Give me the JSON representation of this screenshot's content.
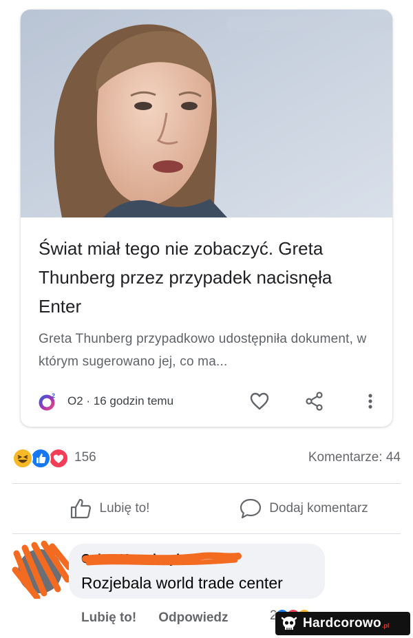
{
  "article": {
    "headline": "Świat miał tego nie zobaczyć. Greta Thunberg przez przypadek nacisnęła Enter",
    "snippet": "Greta Thunberg przypadkowo udostępniła dokument, w którym sugerowano jej, co ma...",
    "source": "O2",
    "time": "16 godzin temu",
    "source_icon": "o2-logo-icon",
    "actions": [
      "heart-icon",
      "share-icon",
      "more-vertical-icon"
    ]
  },
  "post": {
    "reactions_count": "156",
    "reaction_types": [
      "haha",
      "like",
      "love"
    ],
    "comments_label": "Komentarze: 44",
    "like_label": "Lubię to!",
    "comment_label": "Dodaj komentarz"
  },
  "comment": {
    "author": "Oskar Kowalczyk",
    "text": "Rozjebala world trade center",
    "like_label": "Lubię to!",
    "reply_label": "Odpowiedz",
    "reaction_count": "2"
  },
  "watermark": {
    "brand": "Hardcorowo",
    "tld": ".pl"
  },
  "colors": {
    "facebook_blue": "#1877f2",
    "love_red": "#f33e58",
    "haha_yellow": "#f7b928",
    "redaction_orange": "#f26b21",
    "watermark_bg": "#111111"
  }
}
